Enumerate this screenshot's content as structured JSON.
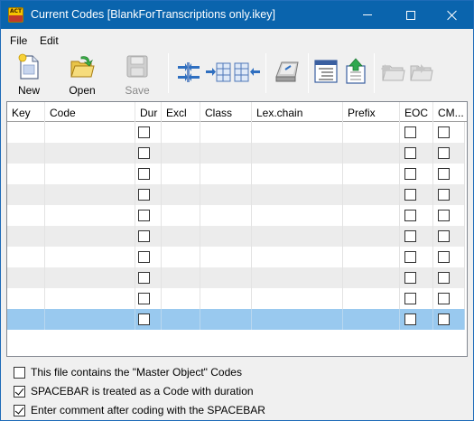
{
  "window": {
    "title": "Current Codes [BlankForTranscriptions only.ikey]",
    "app_icon": "interact-app-icon",
    "app_icon_text": "ACT"
  },
  "menu": {
    "items": [
      {
        "label": "File"
      },
      {
        "label": "Edit"
      }
    ]
  },
  "toolbar": {
    "new_label": "New",
    "open_label": "Open",
    "save_label": "Save",
    "save_enabled": false
  },
  "grid": {
    "columns": [
      "Key",
      "Code",
      "Dur",
      "Excl",
      "Class",
      "Lex.chain",
      "Prefix",
      "EOC",
      "CM..."
    ],
    "rows": [
      {
        "key": "",
        "code": "",
        "dur": false,
        "eoc": false,
        "cm": false
      },
      {
        "key": "",
        "code": "",
        "dur": false,
        "eoc": false,
        "cm": false
      },
      {
        "key": "",
        "code": "",
        "dur": false,
        "eoc": false,
        "cm": false
      },
      {
        "key": "",
        "code": "",
        "dur": false,
        "eoc": false,
        "cm": false
      },
      {
        "key": "",
        "code": "",
        "dur": false,
        "eoc": false,
        "cm": false
      },
      {
        "key": "",
        "code": "",
        "dur": false,
        "eoc": false,
        "cm": false
      },
      {
        "key": "",
        "code": "",
        "dur": false,
        "eoc": false,
        "cm": false
      },
      {
        "key": "",
        "code": "",
        "dur": false,
        "eoc": false,
        "cm": false
      },
      {
        "key": "",
        "code": "",
        "dur": false,
        "eoc": false,
        "cm": false
      },
      {
        "key": "",
        "code": "",
        "dur": false,
        "eoc": false,
        "cm": false,
        "selected": true
      }
    ]
  },
  "options": [
    {
      "label": "This file contains the \"Master Object\" Codes",
      "checked": false
    },
    {
      "label": "SPACEBAR is treated as a Code with duration",
      "checked": true
    },
    {
      "label": "Enter comment after coding with the SPACEBAR",
      "checked": true
    }
  ],
  "colors": {
    "titlebar": "#0a64ad",
    "selected_row": "#99c9ef",
    "alt_row": "#ececec"
  }
}
